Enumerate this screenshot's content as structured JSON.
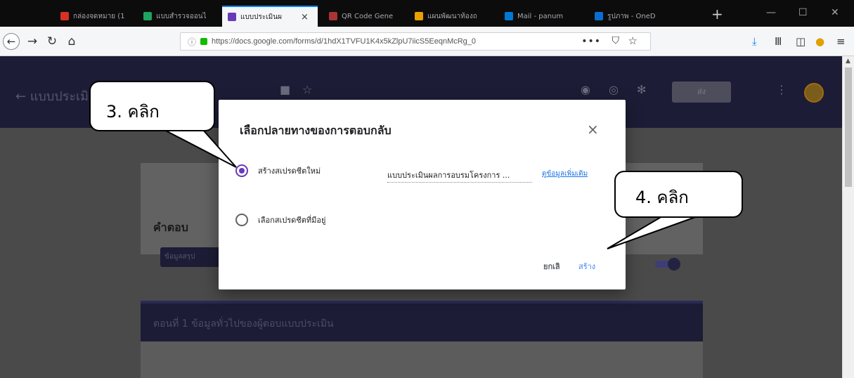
{
  "tabs": [
    {
      "label": "กล่องจดหมาย (1",
      "color": "#d93025",
      "active": false
    },
    {
      "label": "แบบสำรวจออนไ",
      "color": "#1ea362",
      "active": false
    },
    {
      "label": "แบบประเมินผ",
      "color": "#673ab7",
      "active": true,
      "close": "×"
    },
    {
      "label": "QR Code Gene",
      "color": "#a33",
      "active": false
    },
    {
      "label": "แผนพัฒนาท้องถ",
      "color": "#e8a000",
      "active": false
    },
    {
      "label": "Mail - panum",
      "color": "#0078d4",
      "active": false
    },
    {
      "label": "รูปภาพ - OneD",
      "color": "#0a6ed1",
      "active": false
    }
  ],
  "browser": {
    "url": "https://docs.google.com/forms/d/1hdX1TVFU1K4x5kZlpU7iicS5EeqnMcRg_0",
    "dots": "•••",
    "new_tab": "+"
  },
  "form": {
    "title": "แบบประเมินผลการอบรมโครงการ",
    "send_label": "ส่ง",
    "responses_heading": "คำตอบ",
    "summary_button": "ข้อมูลสรุป",
    "section_title": "ตอนที่ 1 ข้อมูลทั่วไปของผู้ตอบแบบประเมิน"
  },
  "dialog": {
    "title": "เลือกปลายทางของการตอบกลับ",
    "option_new": "สร้างสเปรดชีตใหม่",
    "option_existing": "เลือกสเปรดชีตที่มีอยู่",
    "sheet_name": "แบบประเมินผลการอบรมโครงการ ...",
    "more_info": "ดูข้อมูลเพิ่มเติม",
    "cancel": "ยกเลิก",
    "create": "สร้าง",
    "close": "×"
  },
  "annotations": {
    "step3": "3. คลิก",
    "step4": "4. คลิก"
  }
}
